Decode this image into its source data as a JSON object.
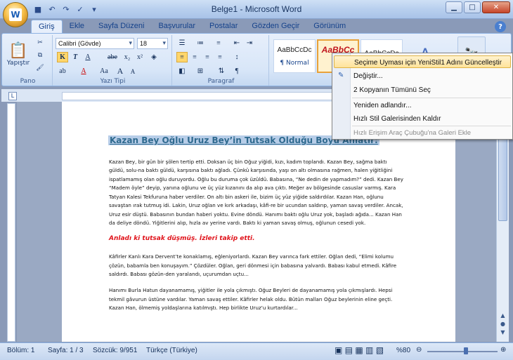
{
  "window": {
    "title": "Belge1 - Microsoft Word"
  },
  "tabs": [
    "Giriş",
    "Ekle",
    "Sayfa Düzeni",
    "Başvurular",
    "Postalar",
    "Gözden Geçir",
    "Görünüm"
  ],
  "ribbon": {
    "clipboard": {
      "paste": "Yapıştır",
      "label": "Pano"
    },
    "font": {
      "name": "Calibri (Gövde)",
      "size": "18",
      "label": "Yazı Tipi",
      "bold": "K",
      "italic": "T",
      "underline": "A",
      "strike": "abe",
      "subscript": "x₂",
      "superscript": "x²",
      "change_case": "Aa",
      "grow": "A",
      "shrink": "A"
    },
    "paragraph": {
      "label": "Paragraf"
    },
    "styles": {
      "items": [
        {
          "preview": "AaBbCcDc",
          "name": "¶ Normal"
        },
        {
          "preview": "AaBbCc",
          "name": "Ye"
        },
        {
          "preview": "AaBbCcDc",
          "name": ""
        }
      ]
    }
  },
  "context_menu": {
    "items": [
      "Seçime Uyması için YeniStil1 Adını Güncelleştir",
      "Değiştir...",
      "2 Kopyanın Tümünü Seç",
      "Yeniden adlandır...",
      "Hızlı Stil Galerisinden Kaldır",
      "Hızlı Erişim Araç Çubuğu'na Galeri Ekle"
    ]
  },
  "document": {
    "heading": "Kazan Bey Oğlu Uruz Bey’in Tutsak Olduğu Boyu Anlatır:",
    "para1": "Kazan Bey, bir gün bir şölen tertip etti. Doksan üç bin Oğuz yiğidi, kızı, kadım toplandı. Kazan Bey, sağma baktı güldü, solu-na baktı güldü, karşısına baktı ağladı. Çünkü karşısında, yaşı on altı olmasına rağmen, halen yiğitliğini ispatlamamış olan oğlu duruyordu. Oğlu bu duruma çok üzüldü. Babasına, “Ne dedin de yapmadım?” dedi. Kazan Bey “Madem öyle” deyip, yanına oğlunu ve üç yüz kızanını da alıp ava çıktı. Meğer av bölgesinde casuslar varmış. Kara Tatyan Kalesi Tekfuruna haber verdiler. On altı bin askeri ile, bizim üç yüz yiğide saldırdılar. Kazan Han, oğlunu savaştan ırak tutmuş idi. Lakin, Uruz oğlan ve kırk arkadaşı, kâfi-re bir ucundan saldırıp, yaman savaş verdiler. Ancak, Uruz esir düştü. Babasının bundan haberi yoktu. Evine döndü. Hanımı baktı oğlu Uruz yok, başladı ağıda... Kazan Han da deliye döndü. Yiğitlerini alıp, hızla av yerine vardı. Baktı ki yaman savaş olmuş, oğlunun cesedi yok.",
    "red": "Anladı ki tutsak düşmüş. İzleri takip etti.",
    "para2": "Kâfirler Kanlı Kara Dervent’te konaklamış, eğleniyorlardı. Kazan Bey varınca fark ettiler. Oğlan dedi, “Elimi kolumu çözün, babamla ben konuşayım.” Çözdüler. Oğlan, geri dönmesi için babasına yalvardı. Babası kabul etmedi. Kâfire saldırdı. Babası gözün-den yaralandı, uçurumdan uçtu...",
    "para3": "Hanımı Burla Hatun dayanamamış, yiğitler ile yola çıkmıştı. Oğuz Beyleri de dayanamamış yola çıkmışlardı. Hepsi tekmil gâvurun üstüne vardılar. Yaman savaş ettiler. Kâfirler helak oldu. Bütün malları Oğuz beylerinin eline geçti. Kazan Han, ölmemiş yoldaşlarına katılmıştı. Hep birlikte Uruz’u kurtardılar..."
  },
  "status": {
    "section": "Bölüm: 1",
    "page": "Sayfa: 1 / 3",
    "words": "Sözcük: 9/951",
    "language": "Türkçe (Türkiye)",
    "zoom": "%80"
  }
}
